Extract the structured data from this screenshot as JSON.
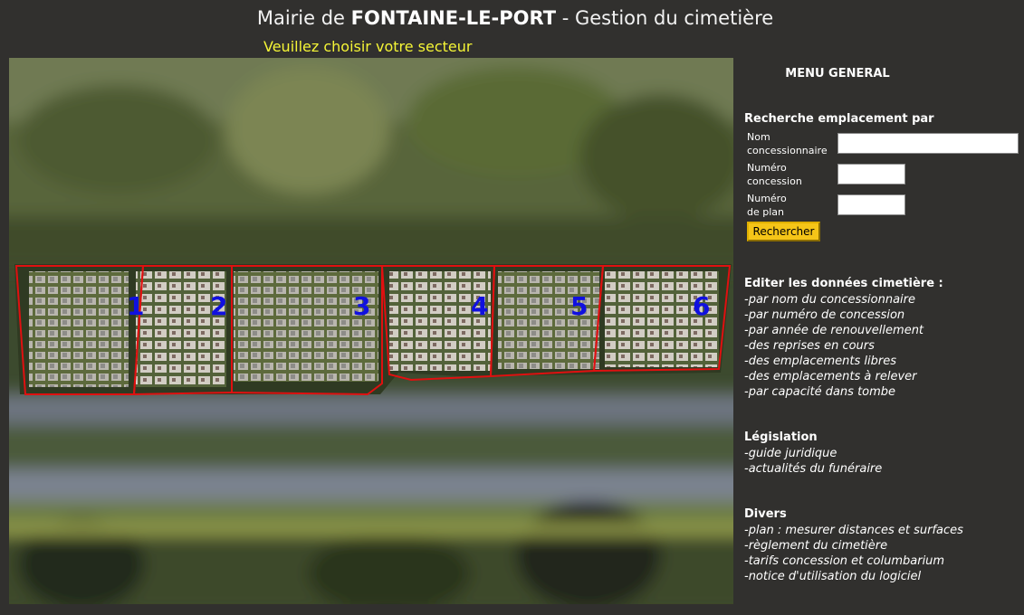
{
  "header": {
    "prefix": "Mairie de ",
    "town": "FONTAINE-LE-PORT",
    "suffix": " - Gestion du cimetière",
    "prompt": "Veuillez choisir votre secteur"
  },
  "map": {
    "sectors": [
      "1",
      "2",
      "3",
      "4",
      "5",
      "6"
    ],
    "sector_label_color": "#1010e0",
    "boundary_color": "#e01010"
  },
  "menu": {
    "title": "MENU GENERAL",
    "search": {
      "title": "Recherche emplacement par",
      "fields": [
        {
          "label_1": "Nom",
          "label_2": "concessionnaire",
          "value": ""
        },
        {
          "label_1": "Numéro",
          "label_2": "concession",
          "value": ""
        },
        {
          "label_1": "Numéro",
          "label_2": "de plan",
          "value": ""
        }
      ],
      "button": "Rechercher"
    },
    "sections": [
      {
        "title": "Editer les données cimetière :",
        "items": [
          "-par nom du concessionnaire",
          "-par numéro de concession",
          "-par année de renouvellement",
          "-des reprises en cours",
          "-des emplacements libres",
          "-des emplacements à relever",
          "-par capacité dans tombe"
        ]
      },
      {
        "title": "Législation",
        "items": [
          "-guide juridique",
          "-actualités du funéraire"
        ]
      },
      {
        "title": "Divers",
        "items": [
          "-plan : mesurer distances et surfaces",
          "-règlement du cimetière",
          "-tarifs concession et columbarium",
          "-notice d'utilisation du logiciel"
        ]
      }
    ]
  },
  "colors": {
    "background": "#31302e",
    "prompt": "#f5f536",
    "button": "#f5c518"
  }
}
